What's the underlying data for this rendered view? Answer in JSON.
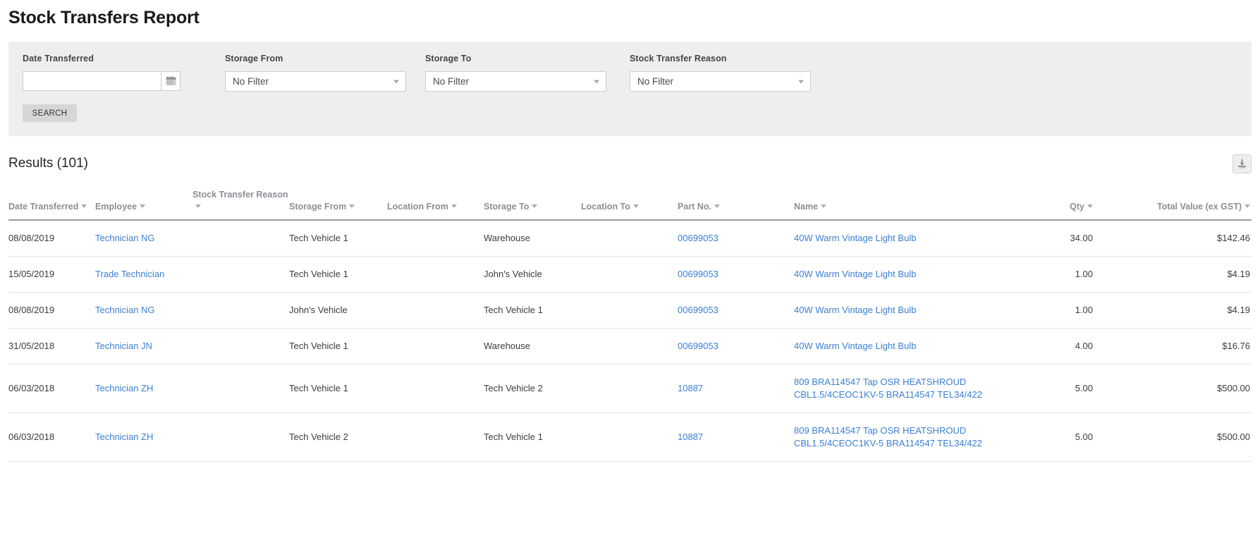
{
  "page": {
    "title": "Stock Transfers Report"
  },
  "filters": {
    "date_transferred": {
      "label": "Date Transferred",
      "value": "",
      "placeholder": "",
      "icon": "calendar-icon"
    },
    "storage_from": {
      "label": "Storage From",
      "value": "No Filter",
      "options": [
        "No Filter"
      ]
    },
    "storage_to": {
      "label": "Storage To",
      "value": "No Filter",
      "options": [
        "No Filter"
      ]
    },
    "stock_transfer_reason": {
      "label": "Stock Transfer Reason",
      "value": "No Filter",
      "options": [
        "No Filter"
      ]
    },
    "search_button": "SEARCH"
  },
  "results": {
    "heading": "Results (101)",
    "count": 101,
    "export_icon": "download-icon",
    "columns": [
      {
        "label": "Date Transferred",
        "align": "left",
        "sortable": true
      },
      {
        "label": "Employee",
        "align": "left",
        "sortable": true
      },
      {
        "label": "Stock Transfer Reason",
        "align": "left",
        "sortable": true
      },
      {
        "label": "Storage From",
        "align": "left",
        "sortable": true
      },
      {
        "label": "Location From",
        "align": "left",
        "sortable": true
      },
      {
        "label": "Storage To",
        "align": "left",
        "sortable": true
      },
      {
        "label": "Location To",
        "align": "left",
        "sortable": true
      },
      {
        "label": "Part No.",
        "align": "left",
        "sortable": true
      },
      {
        "label": "Name",
        "align": "left",
        "sortable": true
      },
      {
        "label": "Qty",
        "align": "right",
        "sortable": true
      },
      {
        "label": "Total Value (ex GST)",
        "align": "right",
        "sortable": true
      }
    ],
    "rows": [
      {
        "date_transferred": "08/08/2019",
        "employee": "Technician NG",
        "stock_transfer_reason": "",
        "storage_from": "Tech Vehicle 1",
        "location_from": "",
        "storage_to": "Warehouse",
        "location_to": "",
        "part_no": "00699053",
        "name": "40W Warm Vintage Light Bulb",
        "qty": "34.00",
        "total_value": "$142.46"
      },
      {
        "date_transferred": "15/05/2019",
        "employee": "Trade Technician",
        "stock_transfer_reason": "",
        "storage_from": "Tech Vehicle 1",
        "location_from": "",
        "storage_to": "John's Vehicle",
        "location_to": "",
        "part_no": "00699053",
        "name": "40W Warm Vintage Light Bulb",
        "qty": "1.00",
        "total_value": "$4.19"
      },
      {
        "date_transferred": "08/08/2019",
        "employee": "Technician NG",
        "stock_transfer_reason": "",
        "storage_from": "John's Vehicle",
        "location_from": "",
        "storage_to": "Tech Vehicle 1",
        "location_to": "",
        "part_no": "00699053",
        "name": "40W Warm Vintage Light Bulb",
        "qty": "1.00",
        "total_value": "$4.19"
      },
      {
        "date_transferred": "31/05/2018",
        "employee": "Technician JN",
        "stock_transfer_reason": "",
        "storage_from": "Tech Vehicle 1",
        "location_from": "",
        "storage_to": "Warehouse",
        "location_to": "",
        "part_no": "00699053",
        "name": "40W Warm Vintage Light Bulb",
        "qty": "4.00",
        "total_value": "$16.76"
      },
      {
        "date_transferred": "06/03/2018",
        "employee": "Technician ZH",
        "stock_transfer_reason": "",
        "storage_from": "Tech Vehicle 1",
        "location_from": "",
        "storage_to": "Tech Vehicle 2",
        "location_to": "",
        "part_no": "10887",
        "name": "809 BRA114547 Tap OSR HEATSHROUD CBL1.5/4CEOC1KV-5 BRA114547 TEL34/422",
        "qty": "5.00",
        "total_value": "$500.00"
      },
      {
        "date_transferred": "06/03/2018",
        "employee": "Technician ZH",
        "stock_transfer_reason": "",
        "storage_from": "Tech Vehicle 2",
        "location_from": "",
        "storage_to": "Tech Vehicle 1",
        "location_to": "",
        "part_no": "10887",
        "name": "809 BRA114547 Tap OSR HEATSHROUD CBL1.5/4CEOC1KV-5 BRA114547 TEL34/422",
        "qty": "5.00",
        "total_value": "$500.00"
      }
    ]
  },
  "colors": {
    "link": "#3b7fd4",
    "panel_background": "#eeeeee",
    "header_text": "#8a8f96",
    "button_background": "#d6d6d6"
  }
}
